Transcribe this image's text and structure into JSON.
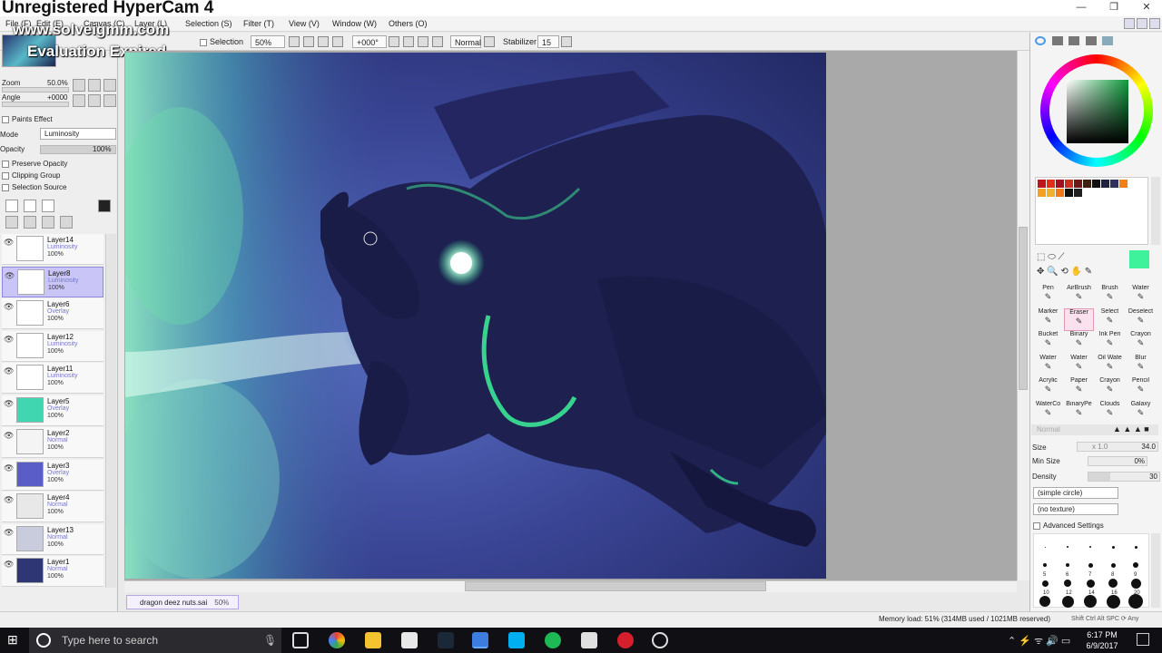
{
  "watermark": {
    "line1": "Unregistered HyperCam 4",
    "line2": "www.solveigmm.com",
    "line3": "Evaluation Expired"
  },
  "menubar": {
    "items": [
      "File (F)",
      "Edit (E)",
      "Canvas (C)",
      "Layer (L)",
      "Selection (S)",
      "Filter (T)",
      "View (V)",
      "Window (W)",
      "Others (O)"
    ]
  },
  "toolbar": {
    "selection_label": "Selection",
    "zoom_value": "50%",
    "angle_value": "+000°",
    "blend_value": "Normal",
    "stabilizer_label": "Stabilizer",
    "stabilizer_value": "15"
  },
  "navigator": {
    "zoom_label": "Zoom",
    "zoom_value": "50.0%",
    "angle_label": "Angle",
    "angle_value": "+0000"
  },
  "layer_props": {
    "paints_effect_label": "Paints Effect",
    "mode_label": "Mode",
    "mode_value": "Luminosity",
    "opacity_label": "Opacity",
    "opacity_value": "100%",
    "preserve_opacity": "Preserve Opacity",
    "clipping_group": "Clipping Group",
    "selection_source": "Selection Source"
  },
  "layers": [
    {
      "name": "Layer14",
      "mode": "Luminosity",
      "opacity": "100%",
      "thumb": "#ffffff",
      "selected": false
    },
    {
      "name": "Layer8",
      "mode": "Luminosity",
      "opacity": "100%",
      "thumb": "#ffffff",
      "selected": true
    },
    {
      "name": "Layer6",
      "mode": "Overlay",
      "opacity": "100%",
      "thumb": "#ffffff",
      "selected": false
    },
    {
      "name": "Layer12",
      "mode": "Luminosity",
      "opacity": "100%",
      "thumb": "#ffffff",
      "selected": false
    },
    {
      "name": "Layer11",
      "mode": "Luminosity",
      "opacity": "100%",
      "thumb": "#ffffff",
      "selected": false
    },
    {
      "name": "Layer5",
      "mode": "Overlay",
      "opacity": "100%",
      "thumb": "#3fd6b0",
      "selected": false
    },
    {
      "name": "Layer2",
      "mode": "Normal",
      "opacity": "100%",
      "thumb": "#f4f4f4",
      "selected": false
    },
    {
      "name": "Layer3",
      "mode": "Overlay",
      "opacity": "100%",
      "thumb": "#5a5cc8",
      "selected": false
    },
    {
      "name": "Layer4",
      "mode": "Normal",
      "opacity": "100%",
      "thumb": "#e8e8e8",
      "selected": false
    },
    {
      "name": "Layer13",
      "mode": "Normal",
      "opacity": "100%",
      "thumb": "#c8ccdc",
      "selected": false
    },
    {
      "name": "Layer1",
      "mode": "Normal",
      "opacity": "100%",
      "thumb": "#2e3676",
      "selected": false
    }
  ],
  "document_tab": {
    "name": "dragon deez nuts.sai",
    "zoom": "50%"
  },
  "tools": [
    [
      "Pen",
      "AirBrush",
      "Brush",
      "Water"
    ],
    [
      "Marker",
      "Eraser",
      "Select",
      "Deselect"
    ],
    [
      "Bucket",
      "Binary",
      "Ink Pen",
      "Crayon"
    ],
    [
      "Water",
      "Water",
      "Oil Wate",
      "Blur"
    ],
    [
      "Acrylic",
      "Paper",
      "Crayon",
      "Pencil"
    ],
    [
      "WaterCo",
      "BinaryPe",
      "Clouds",
      "Galaxy"
    ]
  ],
  "selected_tool": "Eraser",
  "brush": {
    "mode_value": "Normal",
    "size_label": "Size",
    "size_mult": "x 1.0",
    "size_value": "34.0",
    "min_size_label": "Min Size",
    "min_size_value": "0%",
    "density_label": "Density",
    "density_value": "30",
    "shape_value": "(simple circle)",
    "texture_value": "(no texture)",
    "advanced_label": "Advanced Settings",
    "preset_sizes": [
      "5",
      "6",
      "7",
      "8",
      "9",
      "10",
      "12",
      "14",
      "16",
      "20"
    ]
  },
  "colors": {
    "accent_green": "#3df29a",
    "selected_layer": "#c9c5f7",
    "swatches": [
      "#c0141c",
      "#e0301c",
      "#a01020",
      "#c83020",
      "#701818",
      "#402010",
      "#101010",
      "#202040",
      "#303060",
      "#f08018",
      "#f4a020",
      "#f0b030",
      "#f07818",
      "#101010",
      "#202020"
    ]
  },
  "status": {
    "memory": "Memory load: 51% (314MB used / 1021MB reserved)",
    "flags": "Shift Ctrl Alt SPC ⟳ Any"
  },
  "taskbar": {
    "search_placeholder": "Type here to search",
    "time": "6:17 PM",
    "date": "6/9/2017"
  }
}
